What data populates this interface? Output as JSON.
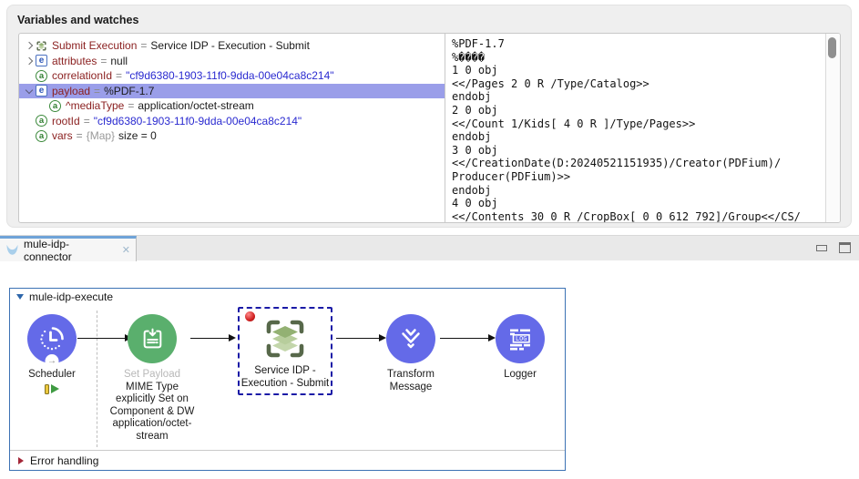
{
  "variables_panel": {
    "title": "Variables and watches",
    "tree": {
      "eq": "=",
      "rows": [
        {
          "name": "Submit Execution",
          "value": "Service IDP - Execution - Submit"
        },
        {
          "name": "attributes",
          "value": "null"
        },
        {
          "name": "correlationId",
          "value": "\"cf9d6380-1903-11f0-9dda-00e04ca8c214\""
        },
        {
          "name": "payload",
          "value": "%PDF-1.7"
        },
        {
          "name": "^mediaType",
          "value": "application/octet-stream"
        },
        {
          "name": "rootId",
          "value": "\"cf9d6380-1903-11f0-9dda-00e04ca8c214\""
        },
        {
          "name": "vars",
          "map_token": "{Map}",
          "value": "size = 0"
        }
      ]
    },
    "preview": {
      "lines": [
        "%PDF-1.7",
        "%����",
        "1 0 obj",
        "<</Pages 2 0 R /Type/Catalog>>",
        "endobj",
        "2 0 obj",
        "<</Count 1/Kids[ 4 0 R ]/Type/Pages>>",
        "endobj",
        "3 0 obj",
        "<</CreationDate(D:20240521151935)/Creator(PDFium)/",
        "Producer(PDFium)>>",
        "endobj",
        "4 0 obj",
        "<</Contents 30 0 R /CropBox[ 0 0 612 792]/Group<</CS/"
      ]
    }
  },
  "editor": {
    "tab_label": "mule-idp-connector",
    "flow_name": "mule-idp-execute",
    "error_handling": "Error handling",
    "nodes": {
      "scheduler": {
        "label": "Scheduler"
      },
      "set_payload": {
        "label": "Set Payload",
        "caption_lines": [
          "MIME Type",
          "explicitly Set on",
          "Component & DW",
          "application/octet-",
          "stream"
        ]
      },
      "idp": {
        "label_line1": "Service IDP -",
        "label_line2": "Execution - Submit"
      },
      "transform": {
        "label": "Transform Message"
      },
      "logger": {
        "label": "Logger",
        "icon_text": "LOG"
      }
    }
  },
  "icons": {
    "close": "✕",
    "expression_letter": "e",
    "attribute_letter": "a",
    "flow_source_arrow": "→"
  },
  "colors": {
    "node_indigo": "#646ae8",
    "node_green": "#5aaf6d",
    "tree_selection": "#9a9ee9",
    "variable_name_maroon": "#8b2121",
    "string_value_blue": "#2a2ad0",
    "tab_accent_blue": "#6fa3d8",
    "flow_border_blue": "#3c72b4",
    "breakpoint_red": "#d02020",
    "error_triangle_red": "#a32638",
    "idp_frame_green": "#57684a",
    "idp_layer_green": "#b7cd9c",
    "mule_logo_blue": "#a9cfeb"
  }
}
